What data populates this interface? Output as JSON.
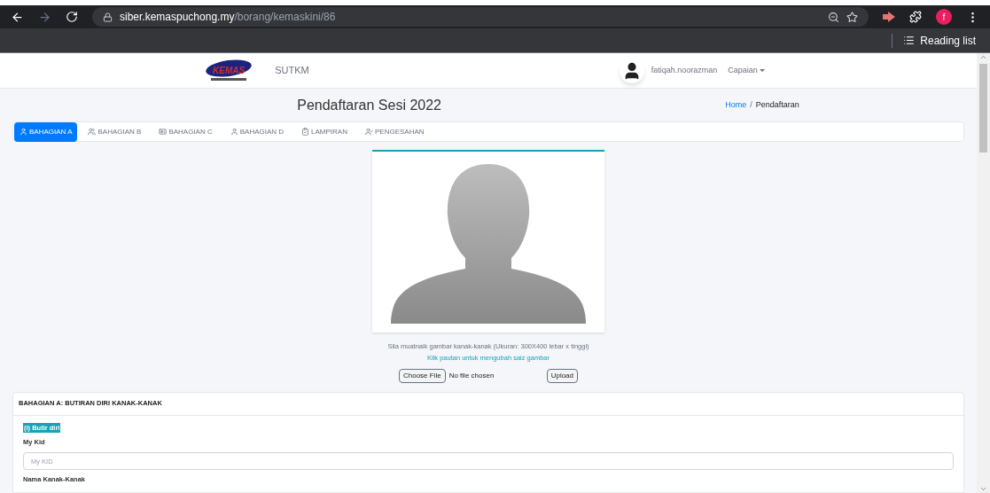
{
  "browser": {
    "url_host": "siber.kemaspuchong.my",
    "url_path": "/borang/kemaskini/86",
    "profile_initial": "f",
    "reading_list": "Reading list"
  },
  "header": {
    "brand": "KEMAS",
    "app_name": "SUTKM",
    "username": "fatiqah.noorazman",
    "menu": "Capaian"
  },
  "page": {
    "title": "Pendaftaran Sesi 2022",
    "breadcrumb": [
      {
        "label": "Home",
        "kind": "link"
      },
      {
        "label": "/",
        "kind": "separator"
      },
      {
        "label": "Pendaftaran",
        "kind": "current"
      }
    ]
  },
  "tabs": [
    {
      "label": "BAHAGIAN A",
      "selected": true
    },
    {
      "label": "BAHAGIAN B",
      "selected": false
    },
    {
      "label": "BAHAGIAN C",
      "selected": false
    },
    {
      "label": "BAHAGIAN D",
      "selected": false
    },
    {
      "label": "LAMPIRAN",
      "selected": false
    },
    {
      "label": "PENGESAHAN",
      "selected": false
    }
  ],
  "photo": {
    "instruction": "Sila muatnaik gambar kanak-kanak (Ukuran: 300X400 lebar x tinggi)",
    "resize_link": "Klik pautan untuk mengubah saiz gambar",
    "choose_button": "Choose File",
    "file_status": "No file chosen",
    "upload_button": "Upload"
  },
  "section": {
    "title": "BAHAGIAN A: BUTIRAN DIRI KANAK-KANAK",
    "subsection": "(i) Butir diri",
    "fields": [
      {
        "label": "My Kid",
        "placeholder": "My KID"
      },
      {
        "label": "Nama Kanak-Kanak"
      }
    ]
  }
}
